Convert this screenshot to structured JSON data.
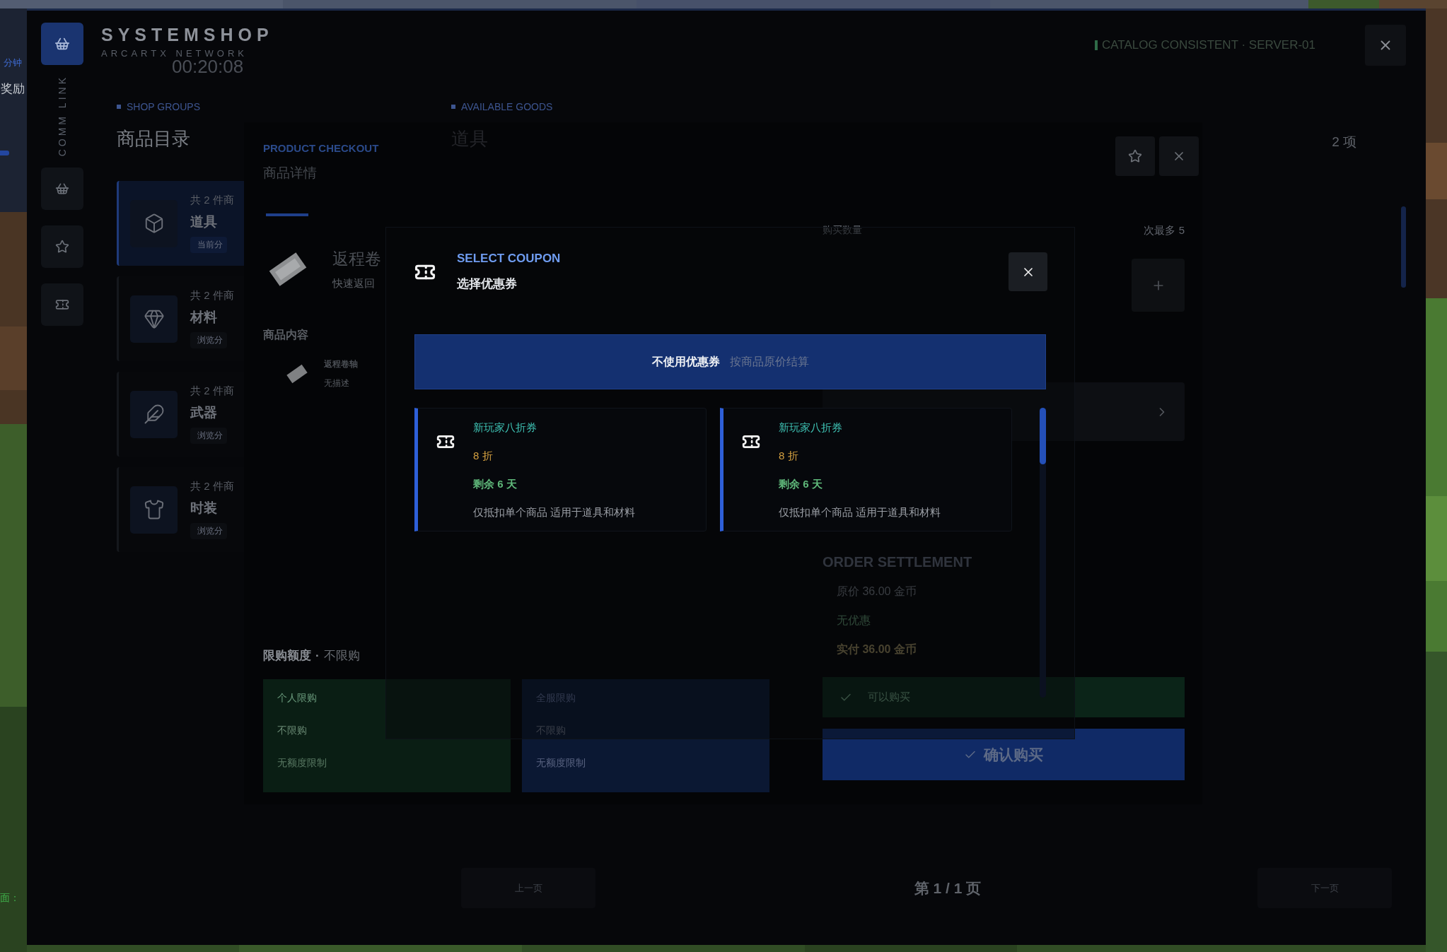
{
  "hud": {
    "minutes_label": "分钟",
    "reward_label": "奖励",
    "footer_fragment": "面："
  },
  "window": {
    "title": "SYSTEMSHOP",
    "subtitle": "ARCARTX NETWORK",
    "timer": "00:20:08",
    "rail_label": "COMM LINK",
    "status": "CATALOG CONSISTENT · SERVER-01"
  },
  "rail": [
    {
      "kind": "basket"
    },
    {
      "kind": "star"
    },
    {
      "kind": "ticket"
    }
  ],
  "groups": {
    "eyebrow": "SHOP GROUPS",
    "title": "商品目录",
    "items": [
      {
        "kind": "cube",
        "count": "共 2 件商",
        "name": "道具",
        "tag": "当前分",
        "selected": true
      },
      {
        "kind": "gem",
        "count": "共 2 件商",
        "name": "材料",
        "tag": "浏览分",
        "selected": false
      },
      {
        "kind": "feather",
        "count": "共 2 件商",
        "name": "武器",
        "tag": "浏览分",
        "selected": false
      },
      {
        "kind": "shirt",
        "count": "共 2 件商",
        "name": "时装",
        "tag": "浏览分",
        "selected": false
      }
    ]
  },
  "goods": {
    "eyebrow": "AVAILABLE GOODS",
    "title": "道具",
    "count": "2 项"
  },
  "pagination": {
    "prev": "上一页",
    "page": "第 1 / 1 页",
    "next": "下一页"
  },
  "checkout": {
    "eyebrow": "PRODUCT CHECKOUT",
    "title": "商品详情",
    "product": {
      "name": "返程卷",
      "subtitle": "快速返回"
    },
    "content_heading": "商品内容",
    "content_item": {
      "name": "返程卷轴",
      "desc": "无描述"
    },
    "limit": {
      "heading": "限购额度",
      "separator": "·",
      "value": "不限购",
      "cards": [
        {
          "kind": "personal",
          "title": "个人限购",
          "value": "不限购",
          "note": "无额度限制"
        },
        {
          "kind": "server",
          "title": "全服限购",
          "value": "不限购",
          "note": "无额度限制"
        }
      ]
    },
    "quantity_label": "购买数量",
    "quantity_note": "次最多 5",
    "settlement": {
      "heading": "ORDER SETTLEMENT",
      "lines": [
        {
          "kind": "original",
          "text": "原价 36.00 金币"
        },
        {
          "kind": "discount",
          "text": "无优惠"
        },
        {
          "kind": "total",
          "text": "实付 36.00 金币"
        }
      ]
    },
    "availability": {
      "text": "可以购买",
      "ok": true
    },
    "confirm": "确认购买"
  },
  "coupon_dialog": {
    "eyebrow": "SELECT COUPON",
    "title": "选择优惠券",
    "no_coupon": {
      "label": "不使用优惠券",
      "hint": "按商品原价结算",
      "selected": true
    },
    "coupons": [
      {
        "name": "新玩家八折券",
        "discount": "8 折",
        "remaining": "剩余 6 天",
        "scope": "仅抵扣单个商品 适用于道具和材料",
        "selected": false
      },
      {
        "name": "新玩家八折券",
        "discount": "8 折",
        "remaining": "剩余 6 天",
        "scope": "仅抵扣单个商品 适用于道具和材料",
        "selected": false
      }
    ]
  }
}
